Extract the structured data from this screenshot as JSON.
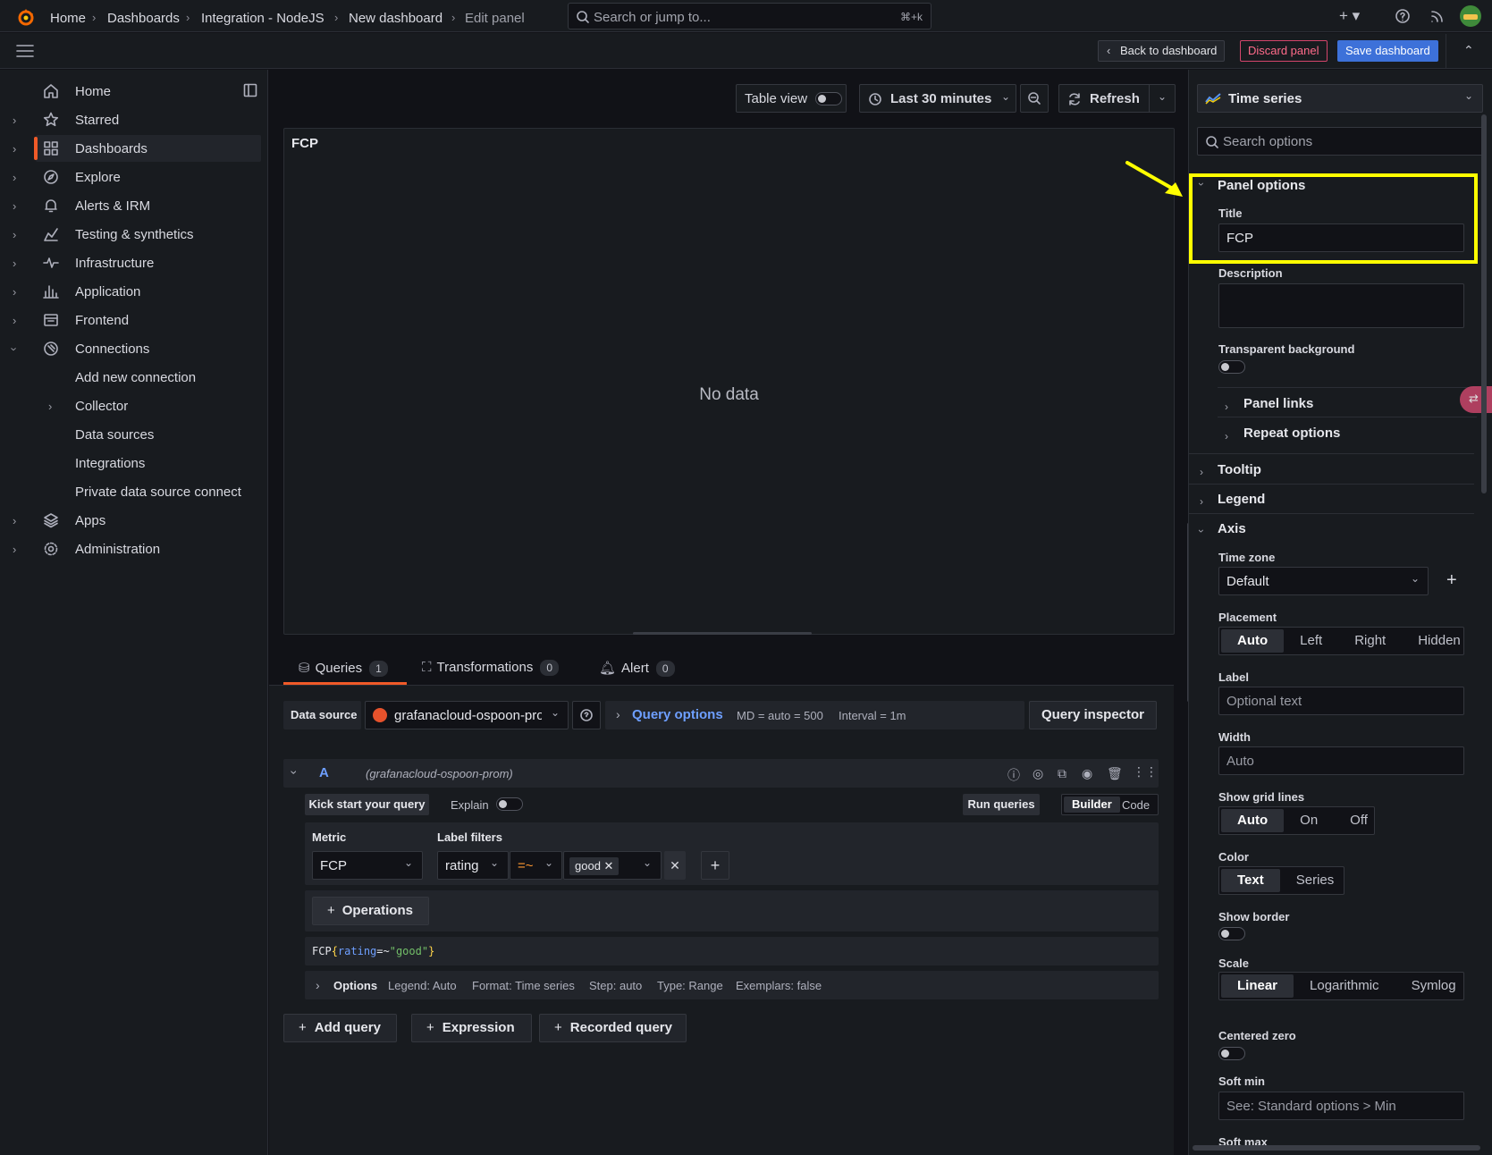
{
  "topbar": {
    "search_placeholder": "Search or jump to...",
    "search_shortcut": "⌘+k"
  },
  "breadcrumb": {
    "items": [
      "Home",
      "Dashboards",
      "Integration - NodeJS",
      "New dashboard",
      "Edit panel"
    ]
  },
  "actions": {
    "back": "Back to dashboard",
    "discard": "Discard panel",
    "save": "Save dashboard"
  },
  "sidebar": {
    "items": [
      {
        "label": "Home"
      },
      {
        "label": "Starred"
      },
      {
        "label": "Dashboards"
      },
      {
        "label": "Explore"
      },
      {
        "label": "Alerts & IRM"
      },
      {
        "label": "Testing & synthetics"
      },
      {
        "label": "Infrastructure"
      },
      {
        "label": "Application"
      },
      {
        "label": "Frontend"
      },
      {
        "label": "Connections"
      },
      {
        "label": "Apps"
      },
      {
        "label": "Administration"
      }
    ],
    "connections_children": [
      "Add new connection",
      "Collector",
      "Data sources",
      "Integrations",
      "Private data source connect"
    ]
  },
  "toolbar": {
    "table_view": "Table view",
    "time_range": "Last 30 minutes",
    "refresh": "Refresh"
  },
  "panel": {
    "title": "FCP",
    "empty": "No data"
  },
  "tabs": [
    {
      "label": "Queries",
      "count": "1"
    },
    {
      "label": "Transformations",
      "count": "0"
    },
    {
      "label": "Alert",
      "count": "0"
    }
  ],
  "datasource": {
    "label": "Data source",
    "value": "grafanacloud-ospoon-prom",
    "query_options": "Query options",
    "md": "MD = auto = 500",
    "interval": "Interval = 1m",
    "inspector": "Query inspector"
  },
  "query": {
    "ref": "A",
    "ds_hint": "(grafanacloud-ospoon-prom)",
    "kick_start": "Kick start your query",
    "explain": "Explain",
    "run": "Run queries",
    "builder": "Builder",
    "code": "Code",
    "metric_label": "Metric",
    "metric_value": "FCP",
    "label_filters": "Label filters",
    "filter_label": "rating",
    "filter_op": "=~",
    "filter_value": "good",
    "operations": "Operations",
    "promql_metric": "FCP",
    "promql_open": "{",
    "promql_key": "rating",
    "promql_op": "=~",
    "promql_val": "\"good\"",
    "promql_close": "}",
    "options_label": "Options",
    "options_summary": [
      "Legend: Auto",
      "Format: Time series",
      "Step: auto",
      "Type: Range",
      "Exemplars: false"
    ]
  },
  "bottom_actions": {
    "add_query": "Add query",
    "expression": "Expression",
    "recorded_query": "Recorded query"
  },
  "options_pane": {
    "viz": "Time series",
    "search_placeholder": "Search options",
    "panel_options": "Panel options",
    "title_label": "Title",
    "title_value": "FCP",
    "description_label": "Description",
    "transparent_label": "Transparent background",
    "panel_links": "Panel links",
    "repeat_options": "Repeat options",
    "tooltip": "Tooltip",
    "legend": "Legend",
    "axis": "Axis",
    "timezone_label": "Time zone",
    "timezone_value": "Default",
    "placement_label": "Placement",
    "placement_options": [
      "Auto",
      "Left",
      "Right",
      "Hidden"
    ],
    "label_label": "Label",
    "label_placeholder": "Optional text",
    "width_label": "Width",
    "width_placeholder": "Auto",
    "grid_label": "Show grid lines",
    "grid_options": [
      "Auto",
      "On",
      "Off"
    ],
    "color_label": "Color",
    "color_options": [
      "Text",
      "Series"
    ],
    "border_label": "Show border",
    "scale_label": "Scale",
    "scale_options": [
      "Linear",
      "Logarithmic",
      "Symlog"
    ],
    "centered_label": "Centered zero",
    "softmin_label": "Soft min",
    "softmin_placeholder": "See: Standard options > Min",
    "softmax_label": "Soft max"
  },
  "colors": {
    "accent": "#f05a28",
    "primary": "#3d71d9",
    "highlight": "#ffff00"
  }
}
